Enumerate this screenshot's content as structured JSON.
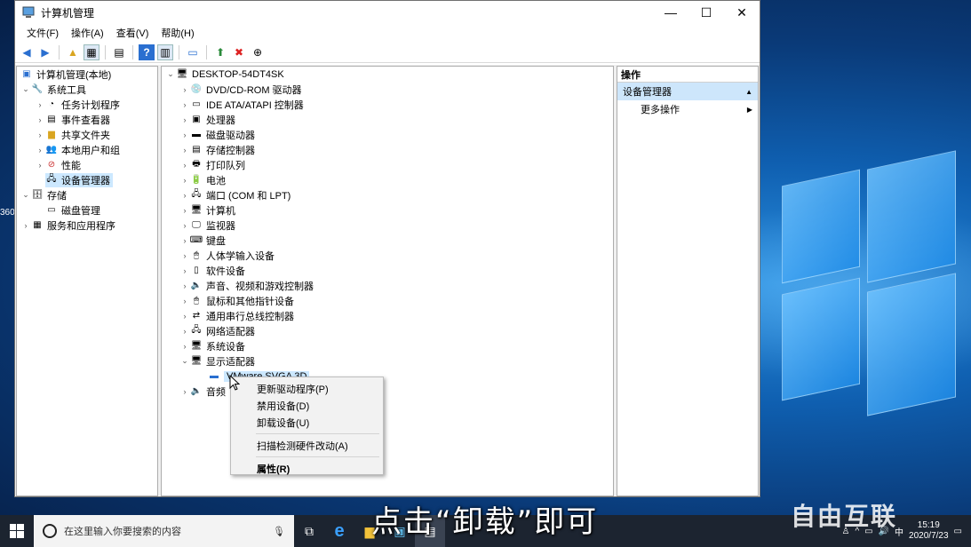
{
  "window": {
    "title": "计算机管理",
    "controls": {
      "minimize": "—",
      "maximize": "☐",
      "close": "✕"
    }
  },
  "menubar": [
    "文件(F)",
    "操作(A)",
    "查看(V)",
    "帮助(H)"
  ],
  "left_tree": {
    "root": "计算机管理(本地)",
    "items": [
      {
        "label": "系统工具",
        "level": 1,
        "expanded": true
      },
      {
        "label": "任务计划程序",
        "level": 2
      },
      {
        "label": "事件查看器",
        "level": 2
      },
      {
        "label": "共享文件夹",
        "level": 2
      },
      {
        "label": "本地用户和组",
        "level": 2
      },
      {
        "label": "性能",
        "level": 2
      },
      {
        "label": "设备管理器",
        "level": 2,
        "selected": true
      },
      {
        "label": "存储",
        "level": 1,
        "expanded": true
      },
      {
        "label": "磁盘管理",
        "level": 2
      },
      {
        "label": "服务和应用程序",
        "level": 1
      }
    ]
  },
  "device_tree": {
    "root": "DESKTOP-54DT4SK",
    "items": [
      "DVD/CD-ROM 驱动器",
      "IDE ATA/ATAPI 控制器",
      "处理器",
      "磁盘驱动器",
      "存储控制器",
      "打印队列",
      "电池",
      "端口 (COM 和 LPT)",
      "计算机",
      "监视器",
      "键盘",
      "人体学输入设备",
      "软件设备",
      "声音、视频和游戏控制器",
      "鼠标和其他指针设备",
      "通用串行总线控制器",
      "网络适配器",
      "系统设备",
      "显示适配器"
    ],
    "child_of_display": "VMware SVGA 3D",
    "partial_after": "音频"
  },
  "actions": {
    "header": "操作",
    "section": "设备管理器",
    "more": "更多操作"
  },
  "context_menu": {
    "items": [
      "更新驱动程序(P)",
      "禁用设备(D)",
      "卸载设备(U)"
    ],
    "scan": "扫描检测硬件改动(A)",
    "properties": "属性(R)"
  },
  "taskbar": {
    "search_placeholder": "在这里输入你要搜索的内容",
    "time": "15:19",
    "date": "2020/7/23",
    "ime": "中"
  },
  "overlay": {
    "subtitle": "点击“卸载”即可",
    "watermark": "自由互联"
  },
  "desktop_fragments": [
    "360"
  ]
}
